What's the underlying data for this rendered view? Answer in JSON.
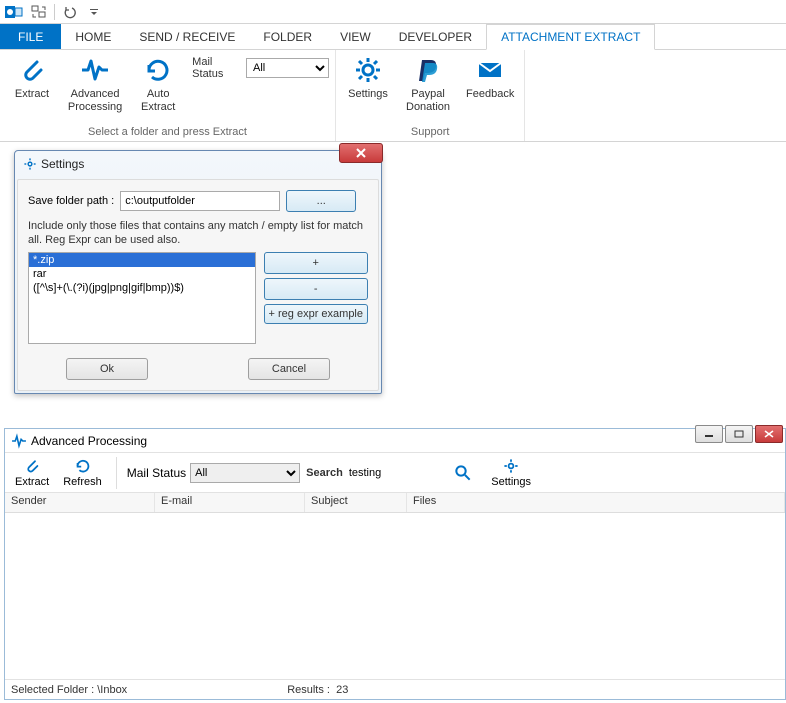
{
  "tabs": {
    "file": "FILE",
    "home": "HOME",
    "sendreceive": "SEND / RECEIVE",
    "folder": "FOLDER",
    "view": "VIEW",
    "developer": "DEVELOPER",
    "attachmentextract": "ATTACHMENT EXTRACT"
  },
  "ribbon": {
    "group1": {
      "extract": "Extract",
      "advancedprocessing": "Advanced\nProcessing",
      "autoextract": "Auto\nExtract",
      "mailstatus_label": "Mail Status",
      "mailstatus_value": "All",
      "label": "Select a folder and press Extract"
    },
    "group2": {
      "settings": "Settings",
      "paypal": "Paypal\nDonation",
      "feedback": "Feedback",
      "label": "Support"
    }
  },
  "settingsDialog": {
    "title": "Settings",
    "savepath_label": "Save folder path :",
    "savepath_value": "c:\\outputfolder",
    "browse": "...",
    "help": "Include only those files that contains any match / empty list for match all. Reg Expr can be used also.",
    "items": [
      "*.zip",
      "rar",
      "([^\\s]+(\\.(?i)(jpg|png|gif|bmp))$)"
    ],
    "add": "+",
    "remove": "-",
    "regexample": "+ reg expr example",
    "ok": "Ok",
    "cancel": "Cancel"
  },
  "advWindow": {
    "title": "Advanced Processing",
    "extract": "Extract",
    "refresh": "Refresh",
    "mailstatus_label": "Mail Status",
    "mailstatus_value": "All",
    "search_label": "Search",
    "search_value": "testing",
    "settings": "Settings",
    "cols": {
      "sender": "Sender",
      "email": "E-mail",
      "subject": "Subject",
      "files": "Files"
    },
    "status_folder_label": "Selected Folder :",
    "status_folder_value": "\\Inbox",
    "status_results_label": "Results :",
    "status_results_value": "23"
  }
}
